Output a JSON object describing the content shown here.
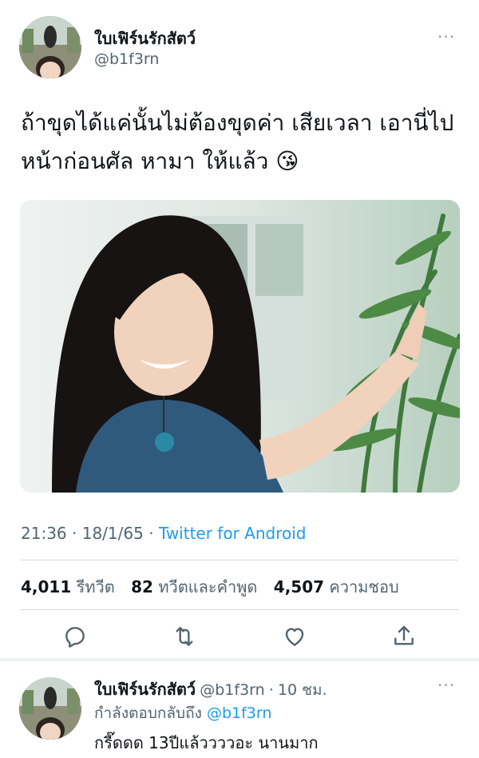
{
  "tweet": {
    "display_name": "ใบเฟิร์นรักสัตว์",
    "handle": "@b1f3rn",
    "text": "ถ้าขุดได้แค่นั้นไม่ต้องขุดค่า เสียเวลา เอานี่ไป หน้าก่อนศัล หามา ให้แล้ว 😘",
    "time": "21:36",
    "date": "18/1/65",
    "separator": "·",
    "source": "Twitter for Android",
    "more_label": "···"
  },
  "stats": {
    "retweets_count": "4,011",
    "retweets_label": "รีทวีต",
    "quotes_count": "82",
    "quotes_label": "ทวีตและคำพูด",
    "likes_count": "4,507",
    "likes_label": "ความชอบ"
  },
  "actions": [
    "reply-icon",
    "retweet-icon",
    "like-icon",
    "share-icon"
  ],
  "reply": {
    "display_name": "ใบเฟิร์นรักสัตว์",
    "handle": "@b1f3rn",
    "separator": "·",
    "time_ago": "10 ชม.",
    "replying_to_label": "กำลังตอบกลับถึง",
    "replying_to_handle": "@b1f3rn",
    "text": "กรี๊ดดด 13ปีแล้ววววอะ นานมาก",
    "more_label": "···"
  },
  "colors": {
    "link": "#1d9bf0",
    "secondary": "#536471",
    "divider": "#cfd9de"
  }
}
